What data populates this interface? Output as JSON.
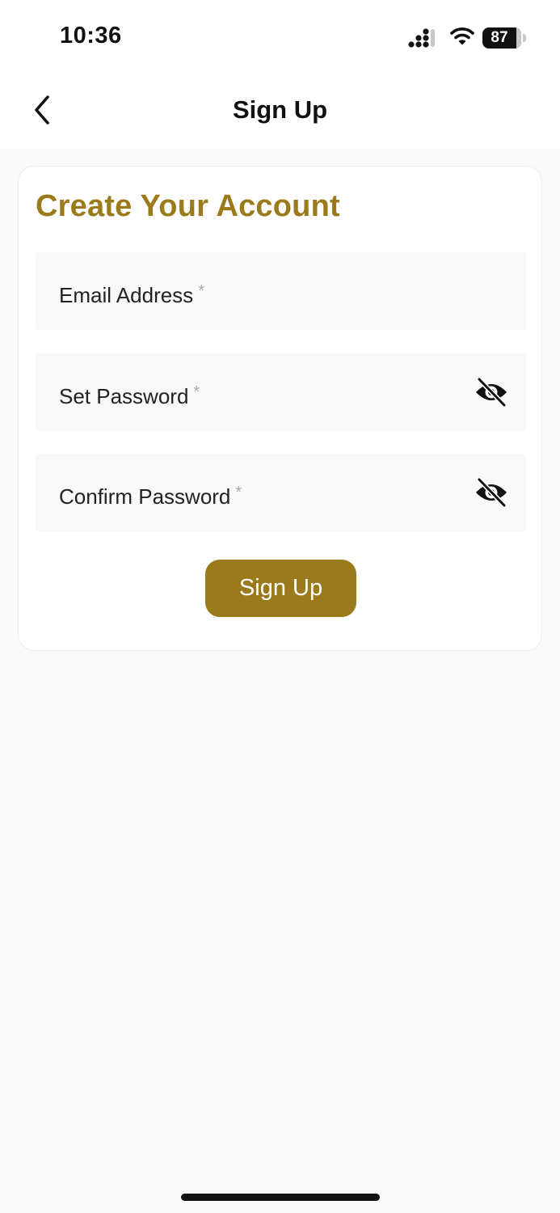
{
  "status_bar": {
    "time": "10:36",
    "battery_level": "87",
    "battery_fraction": 0.87,
    "signal_icon": "cellular-signal-icon",
    "wifi_icon": "wifi-icon"
  },
  "nav": {
    "title": "Sign Up",
    "back_icon": "chevron-left-icon"
  },
  "card": {
    "title": "Create Your Account"
  },
  "form": {
    "email": {
      "label": "Email Address",
      "required_mark": "*"
    },
    "password": {
      "label": "Set Password",
      "required_mark": "*",
      "toggle_icon": "eye-off-icon"
    },
    "confirm_password": {
      "label": "Confirm Password",
      "required_mark": "*",
      "toggle_icon": "eye-off-icon"
    },
    "submit_label": "Sign Up"
  },
  "colors": {
    "accent": "#9b7a1c",
    "background": "#f9f9f9",
    "field_background": "#f8f8f8"
  }
}
